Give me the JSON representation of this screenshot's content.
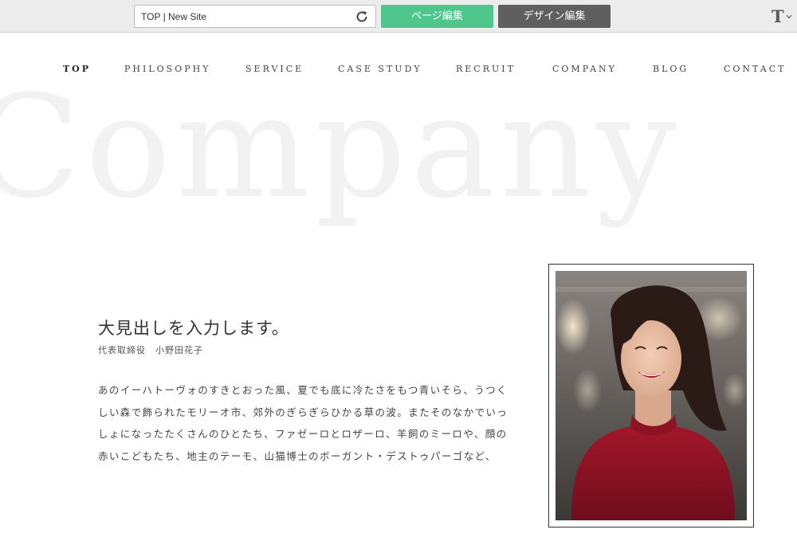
{
  "toolbar": {
    "site_select": "TOP | New Site",
    "page_edit_label": "ページ編集",
    "design_edit_label": "デザイン編集",
    "text_tool_label": "T",
    "colors": {
      "page_edit": "#4fc68b",
      "design_edit": "#5f5f5f"
    }
  },
  "nav": {
    "items": [
      "TOP",
      "PHILOSOPHY",
      "SERVICE",
      "CASE STUDY",
      "RECRUIT",
      "COMPANY",
      "BLOG",
      "CONTACT"
    ],
    "active": "TOP"
  },
  "hero": {
    "word": "Company"
  },
  "content": {
    "heading": "大見出しを入力します。",
    "subheading": "代表取締役　小野田花子",
    "body_lines": [
      "あのイーハトーヴォのすきとおった風、夏でも底に冷たさをもつ青いそら、うつく",
      "しい森で飾られたモリーオ市、郊外のぎらぎらひかる草の波。またそのなかでいっ",
      "しょになったたくさんのひとたち、ファゼーロとロザーロ、羊飼のミーロや、顔の",
      "赤いこどもたち、地主のテーモ、山猫博士のボーガント・デストゥパーゴなど、"
    ]
  },
  "icons": {
    "refresh": "refresh-icon",
    "chevron": "chevron-down-icon"
  }
}
